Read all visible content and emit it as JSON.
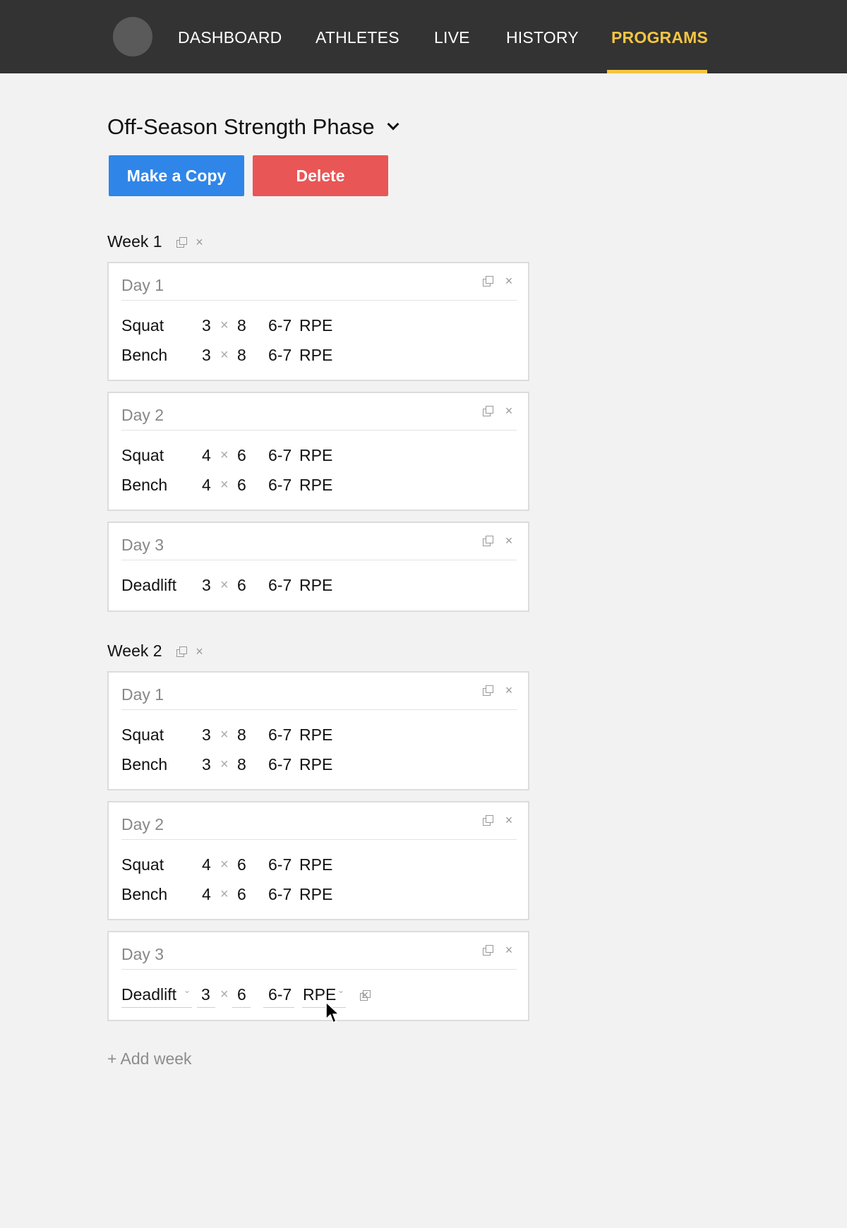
{
  "nav": {
    "items": [
      {
        "label": "DASHBOARD"
      },
      {
        "label": "ATHLETES"
      },
      {
        "label": "LIVE"
      },
      {
        "label": "HISTORY"
      },
      {
        "label": "PROGRAMS",
        "active": true
      }
    ]
  },
  "program": {
    "title": "Off-Season Strength Phase",
    "copy_label": "Make a Copy",
    "delete_label": "Delete"
  },
  "weeks": [
    {
      "label": "Week 1",
      "days": [
        {
          "label": "Day 1",
          "exercises": [
            {
              "name": "Squat",
              "sets": "3",
              "x": "×",
              "reps": "8",
              "intensity": "6-7",
              "unit": "RPE"
            },
            {
              "name": "Bench",
              "sets": "3",
              "x": "×",
              "reps": "8",
              "intensity": "6-7",
              "unit": "RPE"
            }
          ]
        },
        {
          "label": "Day 2",
          "exercises": [
            {
              "name": "Squat",
              "sets": "4",
              "x": "×",
              "reps": "6",
              "intensity": "6-7",
              "unit": "RPE"
            },
            {
              "name": "Bench",
              "sets": "4",
              "x": "×",
              "reps": "6",
              "intensity": "6-7",
              "unit": "RPE"
            }
          ]
        },
        {
          "label": "Day 3",
          "exercises": [
            {
              "name": "Deadlift",
              "sets": "3",
              "x": "×",
              "reps": "6",
              "intensity": "6-7",
              "unit": "RPE"
            }
          ]
        }
      ]
    },
    {
      "label": "Week 2",
      "days": [
        {
          "label": "Day 1",
          "exercises": [
            {
              "name": "Squat",
              "sets": "3",
              "x": "×",
              "reps": "8",
              "intensity": "6-7",
              "unit": "RPE"
            },
            {
              "name": "Bench",
              "sets": "3",
              "x": "×",
              "reps": "8",
              "intensity": "6-7",
              "unit": "RPE"
            }
          ]
        },
        {
          "label": "Day 2",
          "exercises": [
            {
              "name": "Squat",
              "sets": "4",
              "x": "×",
              "reps": "6",
              "intensity": "6-7",
              "unit": "RPE"
            },
            {
              "name": "Bench",
              "sets": "4",
              "x": "×",
              "reps": "6",
              "intensity": "6-7",
              "unit": "RPE"
            }
          ]
        },
        {
          "label": "Day 3",
          "exercises": [
            {
              "name": "Deadlift",
              "sets": "3",
              "x": "×",
              "reps": "6",
              "intensity": "6-7",
              "unit": "RPE"
            }
          ]
        }
      ]
    }
  ],
  "add_week_label": "+ Add week",
  "icons": {
    "copy": "×",
    "close": "×",
    "dropdown": "⌄"
  },
  "colors": {
    "topbar": "#333333",
    "accent": "#f4c542",
    "copy_button": "#2f86e8",
    "delete_button": "#e95656"
  }
}
